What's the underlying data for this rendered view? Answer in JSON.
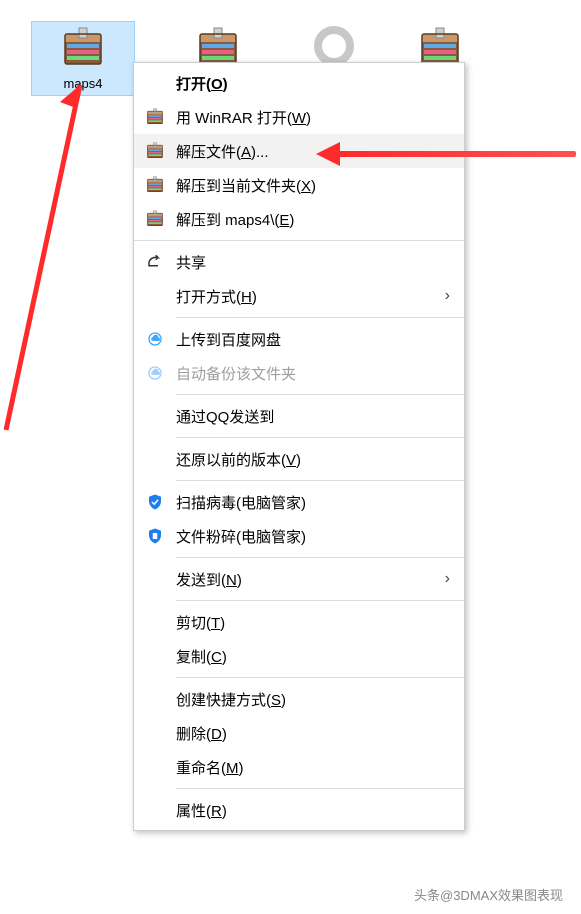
{
  "files": [
    {
      "name": "maps4",
      "selected": true
    },
    {
      "name": "",
      "selected": false
    },
    {
      "name": "",
      "selected": false
    },
    {
      "name": "",
      "selected": false
    }
  ],
  "menu": {
    "open": {
      "label": "打开(",
      "u": "O",
      "after": ")"
    },
    "winrar_open": {
      "label": "用 WinRAR 打开(",
      "u": "W",
      "after": ")"
    },
    "extract_files": {
      "label": "解压文件(",
      "u": "A",
      "after": ")..."
    },
    "extract_here": {
      "label": "解压到当前文件夹(",
      "u": "X",
      "after": ")"
    },
    "extract_to": {
      "label": "解压到 maps4\\(",
      "u": "E",
      "after": ")"
    },
    "share": {
      "label": "共享"
    },
    "open_with": {
      "label": "打开方式(",
      "u": "H",
      "after": ")"
    },
    "baidu_upload": {
      "label": "上传到百度网盘"
    },
    "baidu_backup": {
      "label": "自动备份该文件夹"
    },
    "qq_send": {
      "label": "通过QQ发送到"
    },
    "restore": {
      "label": "还原以前的版本(",
      "u": "V",
      "after": ")"
    },
    "scan": {
      "label": "扫描病毒(电脑管家)"
    },
    "shred": {
      "label": "文件粉碎(电脑管家)"
    },
    "send_to": {
      "label": "发送到(",
      "u": "N",
      "after": ")"
    },
    "cut": {
      "label": "剪切(",
      "u": "T",
      "after": ")"
    },
    "copy": {
      "label": "复制(",
      "u": "C",
      "after": ")"
    },
    "shortcut": {
      "label": "创建快捷方式(",
      "u": "S",
      "after": ")"
    },
    "delete": {
      "label": "删除(",
      "u": "D",
      "after": ")"
    },
    "rename": {
      "label": "重命名(",
      "u": "M",
      "after": ")"
    },
    "props": {
      "label": "属性(",
      "u": "R",
      "after": ")"
    }
  },
  "footer": {
    "text": "头条@3DMAX效果图表现"
  }
}
